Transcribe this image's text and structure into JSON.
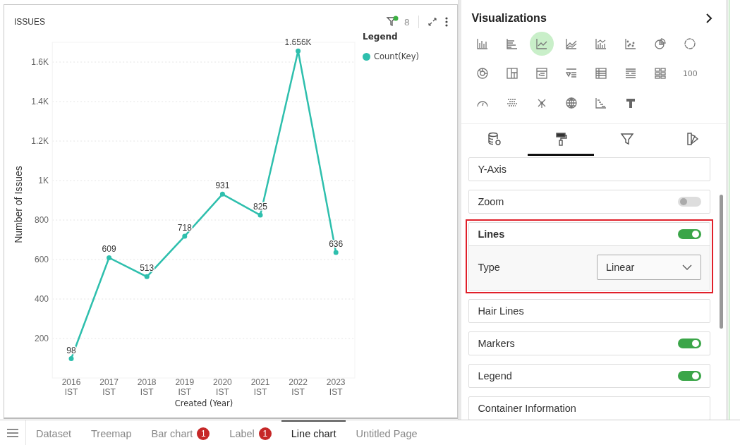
{
  "chart_card": {
    "title": "ISSUES",
    "filter_count": "8",
    "filter_active": true,
    "legend": {
      "title": "Legend"
    },
    "chart_data": {
      "type": "line",
      "xlabel": "Created (Year)",
      "ylabel": "Number of Issues",
      "categories": [
        [
          "2016",
          "IST"
        ],
        [
          "2017",
          "IST"
        ],
        [
          "2018",
          "IST"
        ],
        [
          "2019",
          "IST"
        ],
        [
          "2020",
          "IST"
        ],
        [
          "2021",
          "IST"
        ],
        [
          "2022",
          "IST"
        ],
        [
          "2023",
          "IST"
        ]
      ],
      "series": [
        {
          "name": "Count(Key)",
          "color": "#2ebfad",
          "marker": true,
          "values": [
            98,
            609,
            513,
            718,
            931,
            825,
            1656,
            636
          ]
        }
      ],
      "grid": true,
      "ylim": [
        0,
        1700
      ],
      "value_labels": [
        "98",
        "609",
        "513",
        "718",
        "931",
        "825",
        "1.656K",
        "636"
      ],
      "yticks": [
        {
          "value": 200,
          "label": "200"
        },
        {
          "value": 400,
          "label": "400"
        },
        {
          "value": 600,
          "label": "600"
        },
        {
          "value": 800,
          "label": "800"
        },
        {
          "value": 1000,
          "label": "1K"
        },
        {
          "value": 1200,
          "label": "1.2K"
        },
        {
          "value": 1400,
          "label": "1.4K"
        },
        {
          "value": 1600,
          "label": "1.6K"
        }
      ]
    }
  },
  "visualizations": {
    "title": "Visualizations",
    "items": [
      {
        "kind": "column",
        "selected": false
      },
      {
        "kind": "bar",
        "selected": false
      },
      {
        "kind": "line",
        "selected": true
      },
      {
        "kind": "area",
        "selected": false
      },
      {
        "kind": "combo",
        "selected": false
      },
      {
        "kind": "scatter",
        "selected": false
      },
      {
        "kind": "pie",
        "selected": false
      },
      {
        "kind": "donut",
        "selected": false
      },
      {
        "kind": "sunburst",
        "selected": false
      },
      {
        "kind": "treemap",
        "selected": false
      },
      {
        "kind": "pivot",
        "selected": false
      },
      {
        "kind": "filterlist",
        "selected": false
      },
      {
        "kind": "table",
        "selected": false
      },
      {
        "kind": "list",
        "selected": false
      },
      {
        "kind": "cards",
        "selected": false
      },
      {
        "kind": "number",
        "label": "100",
        "selected": false
      },
      {
        "kind": "gauge",
        "selected": false
      },
      {
        "kind": "heatmap",
        "selected": false
      },
      {
        "kind": "network",
        "selected": false
      },
      {
        "kind": "globe",
        "selected": false
      },
      {
        "kind": "waterfall",
        "selected": false
      },
      {
        "kind": "text",
        "selected": false
      }
    ]
  },
  "panel_tabs": [
    {
      "kind": "data",
      "selected": false
    },
    {
      "kind": "format",
      "selected": true
    },
    {
      "kind": "filter",
      "selected": false
    },
    {
      "kind": "theme",
      "selected": false
    }
  ],
  "sections": [
    {
      "kind": "plain",
      "label": "Y-Axis"
    },
    {
      "kind": "toggle",
      "label": "Zoom",
      "on": false
    },
    {
      "kind": "expanded",
      "label": "Lines",
      "on": true,
      "highlighted": true,
      "field": {
        "label": "Type",
        "value": "Linear"
      }
    },
    {
      "kind": "plain",
      "label": "Hair Lines"
    },
    {
      "kind": "toggle",
      "label": "Markers",
      "on": true
    },
    {
      "kind": "toggle",
      "label": "Legend",
      "on": true
    },
    {
      "kind": "plain",
      "label": "Container Information"
    }
  ],
  "page_tabs": [
    {
      "label": "Dataset",
      "selected": false
    },
    {
      "label": "Treemap",
      "selected": false
    },
    {
      "label": "Bar chart",
      "badge": "1",
      "selected": false
    },
    {
      "label": "Label",
      "badge": "1",
      "selected": false
    },
    {
      "label": "Line chart",
      "selected": true
    },
    {
      "label": "Untitled Page",
      "selected": false
    }
  ]
}
